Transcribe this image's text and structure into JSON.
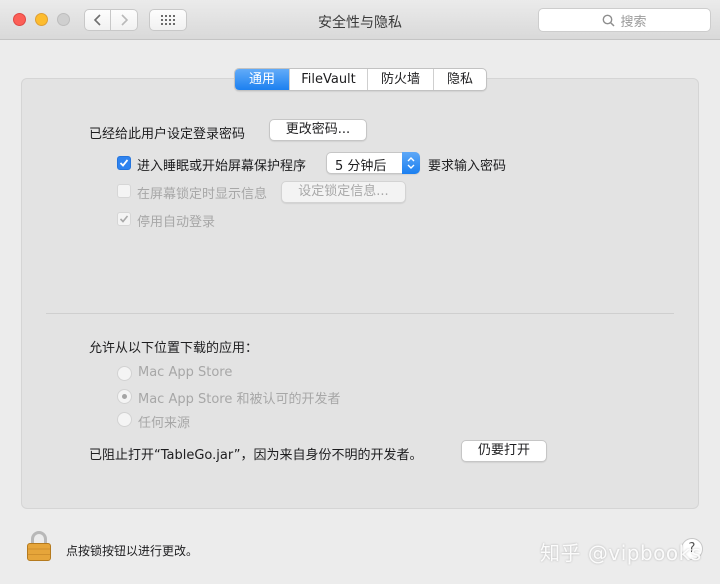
{
  "window": {
    "title": "安全性与隐私"
  },
  "search": {
    "placeholder": "搜索"
  },
  "tabs": [
    {
      "label": "通用",
      "active": true
    },
    {
      "label": "FileVault",
      "active": false
    },
    {
      "label": "防火墙",
      "active": false
    },
    {
      "label": "隐私",
      "active": false
    }
  ],
  "general": {
    "password_label": "已经给此用户设定登录密码",
    "change_password_button": "更改密码...",
    "require_password": {
      "checked": true,
      "label": "进入睡眠或开始屏幕保护程序",
      "delay_value": "5 分钟后",
      "suffix": "要求输入密码"
    },
    "show_message": {
      "checked": false,
      "enabled": false,
      "label": "在屏幕锁定时显示信息",
      "button": "设定锁定信息..."
    },
    "disable_autologin": {
      "checked": true,
      "enabled": false,
      "label": "停用自动登录"
    }
  },
  "downloads": {
    "heading": "允许从以下位置下载的应用：",
    "options": [
      {
        "label": "Mac App Store",
        "selected": false
      },
      {
        "label": "Mac App Store 和被认可的开发者",
        "selected": true
      },
      {
        "label": "任何来源",
        "selected": false
      }
    ],
    "blocked_message": "已阻止打开“TableGo.jar”，因为来自身份不明的开发者。",
    "open_anyway_button": "仍要打开"
  },
  "footer": {
    "lock_text": "点按锁按钮以进行更改。",
    "help_label": "?",
    "watermark": "知乎 @vipbooks"
  },
  "colors": {
    "accent": "#1c80f0",
    "panel": "#e3e3e3",
    "window": "#ececec"
  }
}
